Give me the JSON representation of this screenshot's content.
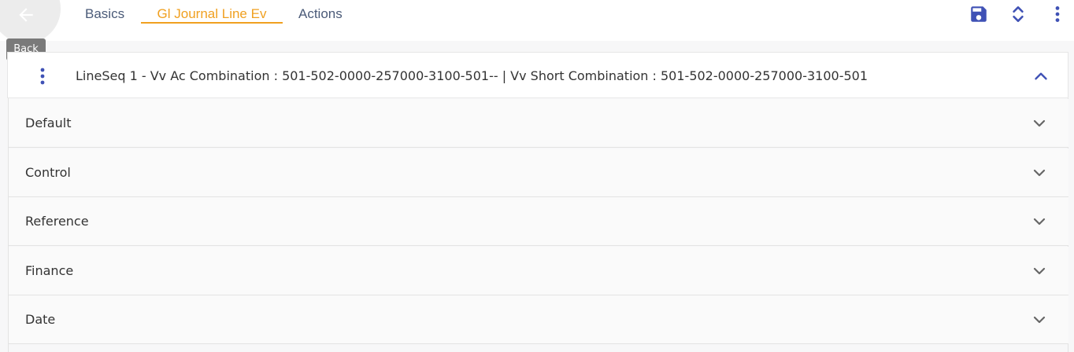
{
  "header": {
    "back_tooltip": "Back",
    "tabs": [
      {
        "label": "Basics",
        "active": false
      },
      {
        "label": "Gl Journal Line Ev",
        "active": true
      },
      {
        "label": "Actions",
        "active": false
      }
    ],
    "icons": [
      "arrow-left-icon",
      "save-icon",
      "expand-collapse-icon",
      "more-vertical-icon"
    ]
  },
  "panel": {
    "title": "LineSeq 1 - Vv Ac Combination  : 501-502-0000-257000-3100-501-- | Vv Short Combination  : 501-502-0000-257000-3100-501",
    "expanded": true
  },
  "sections": [
    {
      "label": "Default"
    },
    {
      "label": "Control"
    },
    {
      "label": "Reference"
    },
    {
      "label": "Finance"
    },
    {
      "label": "Date"
    }
  ],
  "colors": {
    "accent": "#f0a020",
    "tab_text": "#4a5a78",
    "primary_icon": "#3f51b5"
  }
}
